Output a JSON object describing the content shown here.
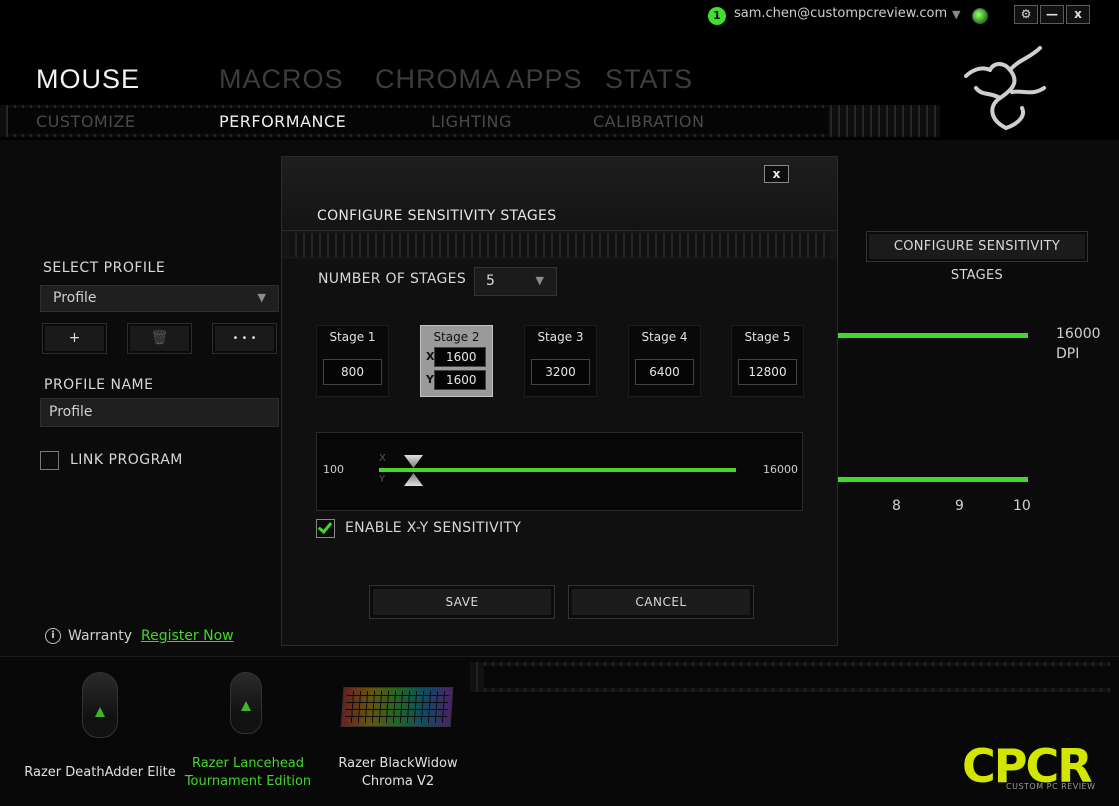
{
  "header": {
    "notification_count": "1",
    "user_email": "sam.chen@custompcreview.com",
    "window_controls": {
      "settings": "⚙",
      "minimize": "—",
      "close": "x"
    }
  },
  "main_tabs": [
    {
      "label": "MOUSE",
      "active": true
    },
    {
      "label": "MACROS",
      "active": false
    },
    {
      "label": "CHROMA APPS",
      "active": false
    },
    {
      "label": "STATS",
      "active": false
    }
  ],
  "sub_tabs": [
    {
      "label": "CUSTOMIZE",
      "active": false
    },
    {
      "label": "PERFORMANCE",
      "active": true
    },
    {
      "label": "LIGHTING",
      "active": false
    },
    {
      "label": "CALIBRATION",
      "active": false
    }
  ],
  "left_panel": {
    "select_profile_label": "SELECT PROFILE",
    "profile_value": "Profile",
    "add_btn": "+",
    "delete_btn": "🗑",
    "more_btn": "• • •",
    "profile_name_label": "PROFILE NAME",
    "profile_name_value": "Profile",
    "link_program_label": "LINK PROGRAM",
    "warranty_label": "Warranty",
    "register_label": "Register Now"
  },
  "behind_panel": {
    "configure_btn": "CONFIGURE SENSITIVITY STAGES",
    "max_value": "16000",
    "unit": "DPI",
    "ticks": [
      "8",
      "9",
      "10"
    ]
  },
  "dialog": {
    "close_label": "x",
    "title": "CONFIGURE SENSITIVITY STAGES",
    "num_stages_label": "NUMBER OF STAGES",
    "num_stages_value": "5",
    "stages": [
      {
        "name": "Stage 1",
        "value": "800"
      },
      {
        "name": "Stage 2",
        "x": "1600",
        "y": "1600",
        "active": true
      },
      {
        "name": "Stage 3",
        "value": "3200"
      },
      {
        "name": "Stage 4",
        "value": "6400"
      },
      {
        "name": "Stage 5",
        "value": "12800"
      }
    ],
    "slider": {
      "min": "100",
      "max": "16000",
      "x_label": "X",
      "y_label": "Y"
    },
    "enable_xy_label": "ENABLE X-Y SENSITIVITY",
    "enable_xy_checked": true,
    "save_label": "SAVE",
    "cancel_label": "CANCEL"
  },
  "devices": [
    {
      "name_line1": "Razer DeathAdder Elite",
      "name_line2": "",
      "active": false
    },
    {
      "name_line1": "Razer Lancehead",
      "name_line2": "Tournament Edition",
      "active": true
    },
    {
      "name_line1": "Razer BlackWidow",
      "name_line2": "Chroma V2",
      "active": false
    }
  ],
  "branding": {
    "logo_text": "CPCR",
    "logo_subtext": "CUSTOM PC REVIEW"
  },
  "colors": {
    "accent": "#44d62c",
    "background": "#0b0b0b",
    "logo": "#d2e600"
  }
}
